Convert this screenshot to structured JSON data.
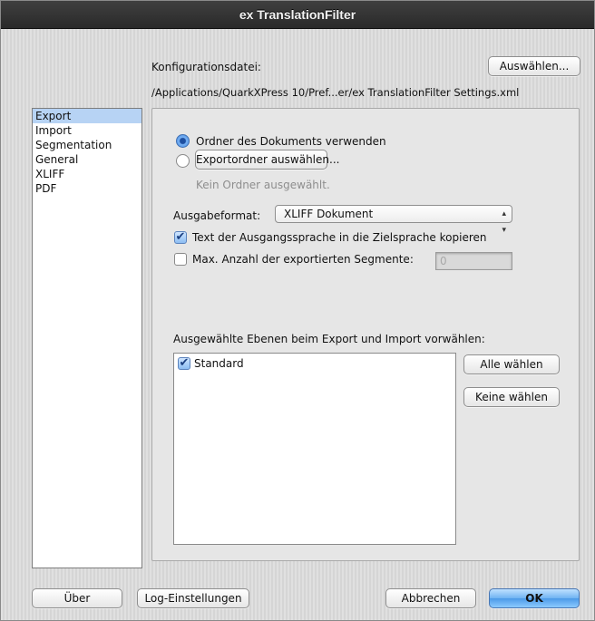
{
  "window": {
    "title": "ex TranslationFilter"
  },
  "config": {
    "label": "Konfigurationsdatei:",
    "choose_button": "Auswählen...",
    "path": "/Applications/QuarkXPress 10/Pref...er/ex TranslationFilter Settings.xml"
  },
  "sidebar": {
    "items": [
      {
        "label": "Export",
        "selected": true
      },
      {
        "label": "Import",
        "selected": false
      },
      {
        "label": "Segmentation",
        "selected": false
      },
      {
        "label": "General",
        "selected": false
      },
      {
        "label": "XLIFF",
        "selected": false
      },
      {
        "label": "PDF",
        "selected": false
      }
    ]
  },
  "export": {
    "radio_use_doc_folder": "Ordner des Dokuments verwenden",
    "radio_use_doc_folder_selected": true,
    "choose_export_folder_button": "Exportordner auswählen...",
    "no_folder_text": "Kein Ordner ausgewählt.",
    "output_format_label": "Ausgabeformat:",
    "output_format_value": "XLIFF Dokument",
    "copy_source_text_label": "Text der Ausgangssprache in die Zielsprache kopieren",
    "copy_source_text_checked": true,
    "max_segments_label": "Max. Anzahl der exportierten Segmente:",
    "max_segments_checked": false,
    "max_segments_value": "0",
    "layers_label": "Ausgewählte Ebenen beim Export und Import vorwählen:",
    "layers": [
      {
        "label": "Standard",
        "checked": true
      }
    ],
    "select_all_button": "Alle wählen",
    "select_none_button": "Keine wählen"
  },
  "footer": {
    "about_button": "Über",
    "log_settings_button": "Log-Einstellungen",
    "cancel_button": "Abbrechen",
    "ok_button": "OK"
  },
  "colors": {
    "titlebar": "#2f2f2f",
    "selection": "#b7d3f4",
    "default_button": "#6fb3f2"
  }
}
